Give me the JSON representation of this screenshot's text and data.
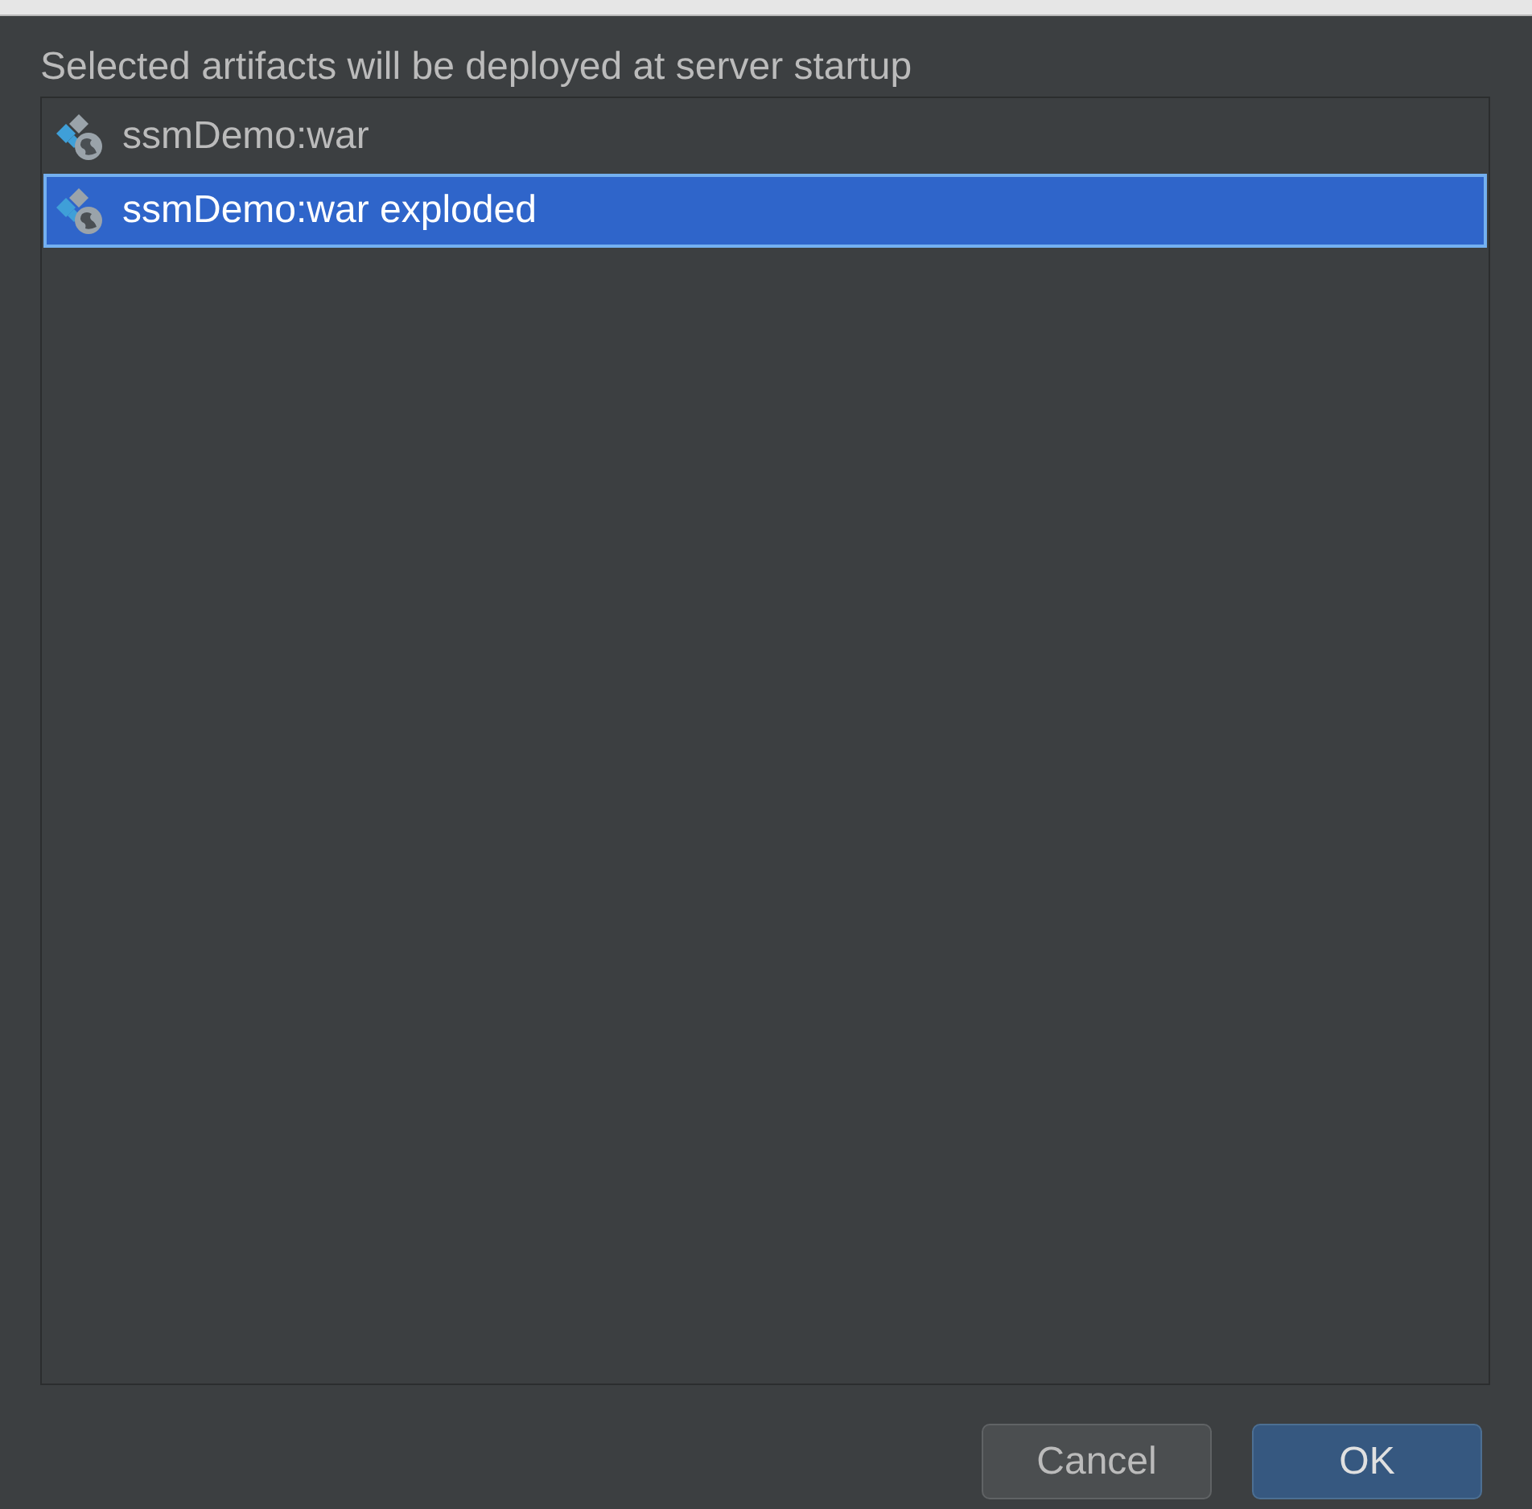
{
  "instruction": "Selected artifacts will be deployed at server startup",
  "artifacts": [
    {
      "label": "ssmDemo:war",
      "selected": false
    },
    {
      "label": "ssmDemo:war exploded",
      "selected": true
    }
  ],
  "buttons": [
    {
      "label": "Cancel",
      "kind": "secondary"
    },
    {
      "label": "OK",
      "kind": "default"
    }
  ]
}
